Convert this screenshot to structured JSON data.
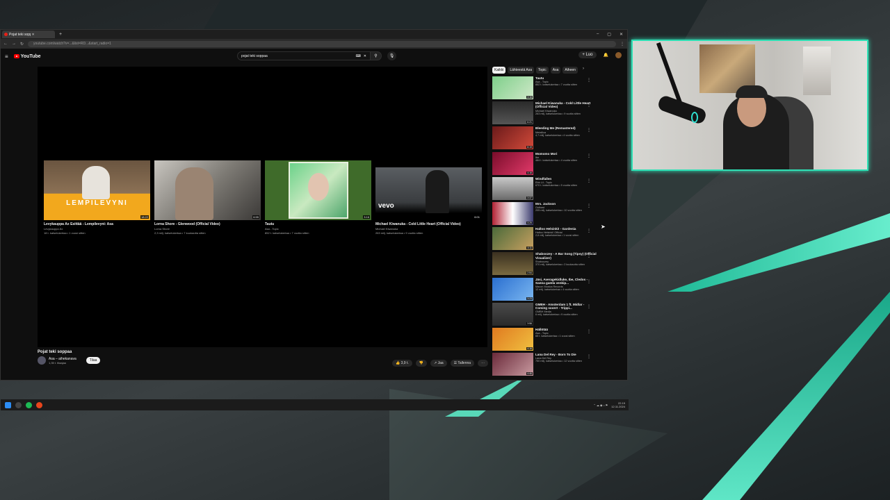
{
  "browser": {
    "tab_title": "Pojat teki soppaa - YouTube",
    "url": "youtube.com/watch?v=...&list=RD...&start_radio=1",
    "window_controls": [
      "–",
      "▢",
      "✕"
    ]
  },
  "youtube": {
    "logo_text": "YouTube",
    "search_value": "pojat teki soppaa",
    "create_label": "+ Luo"
  },
  "endscreen": [
    {
      "title": "Levykauppa Äx Esittää - Lempilevyni: Asa",
      "channel": "Levykauppa Äx",
      "meta": "18 t. katselukertaa • 1 vuosi sitten",
      "duration": "18:22",
      "label": "LEMPILEVYNI"
    },
    {
      "title": "Lorna Shore - Glenwood (Official Video)",
      "channel": "Lorna Shore",
      "meta": "2,3 milj. katselukertaa • 7 kuukautta sitten",
      "duration": "6:55"
    },
    {
      "title": "Tautu",
      "channel": "Asa - Topic",
      "meta": "852 t. katselukertaa • 7 vuotta sitten",
      "duration": "3:16"
    },
    {
      "title": "Michael Kiwanuka - Cold Little Heart (Official Video)",
      "channel": "Michael Kiwanuka",
      "meta": "263 milj. katselukertaa • 9 vuotta sitten",
      "duration": "6:01",
      "label": "vevo"
    }
  ],
  "video": {
    "title": "Pojat teki soppaa",
    "channel": "Asa – aihekanava",
    "subscribers": "1,35 t. tilaajaa",
    "subscribe_label": "Tilaa",
    "like_count": "3,9 t.",
    "share_label": "Jaa",
    "save_label": "Tallenna",
    "more_label": "⋯"
  },
  "chips": [
    "Kaikki",
    "Lähteestä Asa",
    "Topic",
    "Asa",
    "Aiheen"
  ],
  "sidebar": [
    {
      "title": "Tautu",
      "channel": "Asa - Topic",
      "meta": "852 t. katselukertaa • 7 vuotta sitten",
      "duration": "3:16"
    },
    {
      "title": "Michael Kiwanuka - Cold Little Heart (Official Video)",
      "channel": "Michael Kiwanuka",
      "meta": "263 milj. katselukertaa • 9 vuotta sitten",
      "duration": "6:21"
    },
    {
      "title": "Bleeding Me (Remastered)",
      "channel": "Metallica",
      "meta": "4,7 milj. katselukertaa • 4 vuotta sitten",
      "duration": "8:19"
    },
    {
      "title": "Momomo Mori",
      "channel": "Ibe",
      "meta": "484 t. katselukertaa • 4 vuotta sitten",
      "duration": "4:16"
    },
    {
      "title": "Windfallen",
      "channel": "Ebb Lil - Topic",
      "meta": "670 t. katselukertaa • 5 vuotta sitten",
      "duration": "3:37"
    },
    {
      "title": "Mrs. Jackson",
      "channel": "Outkast",
      "meta": "205 milj. katselukertaa • 10 vuotta sitten",
      "duration": "4:25"
    },
    {
      "title": "Halloo Helsinki! - Gardenia",
      "channel": "Halloo Helsinki! Official",
      "meta": "2,6 milj. katselukertaa • 1 vuosi sitten",
      "duration": "4:11"
    },
    {
      "title": "Shaboozey - A Bar Song (Tipsy) (Official Visualizer)",
      "channel": "Shaboozey",
      "meta": "370 milj. katselukertaa • 2 kuukautta sitten",
      "duration": "2:54"
    },
    {
      "title": "Jäsi, Averagekidluke, Ibe, Cledos - Sanna gamla venkip...",
      "channel": "Macon Musica Records",
      "meta": "12 milj. katselukertaa • 4 vuotta sitten",
      "duration": "3:23"
    },
    {
      "title": "GMBH - Amsterdam 1 ft. Midlar - Coming soon!! - Trippi...",
      "channel": "GMBH Media",
      "meta": "6 milj. katselukertaa • 9 vuotta sitten",
      "duration": "3:56"
    },
    {
      "title": "Hällötää",
      "channel": "Asa - Topic",
      "meta": "65 t. katselukertaa • 1 vuosi sitten",
      "duration": "4:16"
    },
    {
      "title": "Lana Del Rey - Born To Die",
      "channel": "Lana Del Rey",
      "meta": "750 milj. katselukertaa • 12 vuotta sitten",
      "duration": "4:46"
    }
  ],
  "taskbar": {
    "clock": "22.19",
    "date": "12.11.2024"
  },
  "colors": {
    "accent": "#2fe0b5",
    "yt_red": "#ff0000"
  }
}
